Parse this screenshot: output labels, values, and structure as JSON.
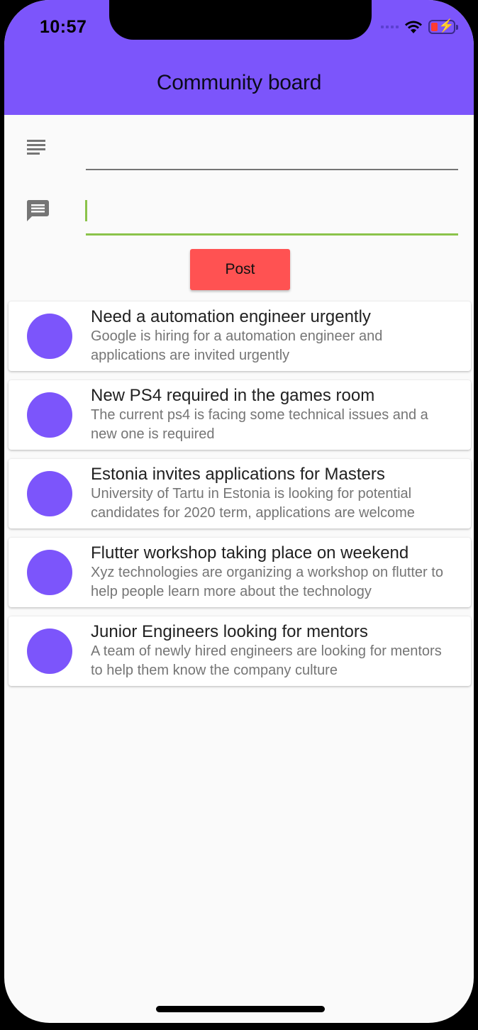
{
  "status_bar": {
    "time": "10:57"
  },
  "app_bar": {
    "title": "Community board"
  },
  "form": {
    "title_field": {
      "value": "",
      "placeholder": ""
    },
    "description_field": {
      "value": "",
      "placeholder": ""
    },
    "post_label": "Post"
  },
  "posts": [
    {
      "title": "Need a automation engineer urgently",
      "body": "Google is hiring for a automation engineer and applications are invited urgently"
    },
    {
      "title": "New PS4 required in the games room",
      "body": "The current ps4 is facing some technical issues and a new one is required"
    },
    {
      "title": "Estonia invites applications for Masters",
      "body": "University of Tartu in Estonia is looking for potential candidates for 2020 term, applications are welcome"
    },
    {
      "title": "Flutter workshop taking place on weekend",
      "body": "Xyz technologies are organizing a workshop on flutter to help people learn more about the technology"
    },
    {
      "title": "Junior Engineers looking for mentors",
      "body": "A team of newly hired engineers are looking for mentors to help them know the company culture"
    }
  ],
  "colors": {
    "accent": "#7c55fb",
    "button": "#ff5252",
    "focus_line": "#8bc34a"
  },
  "icons": {
    "title_field": "subject-icon",
    "description_field": "message-icon"
  }
}
